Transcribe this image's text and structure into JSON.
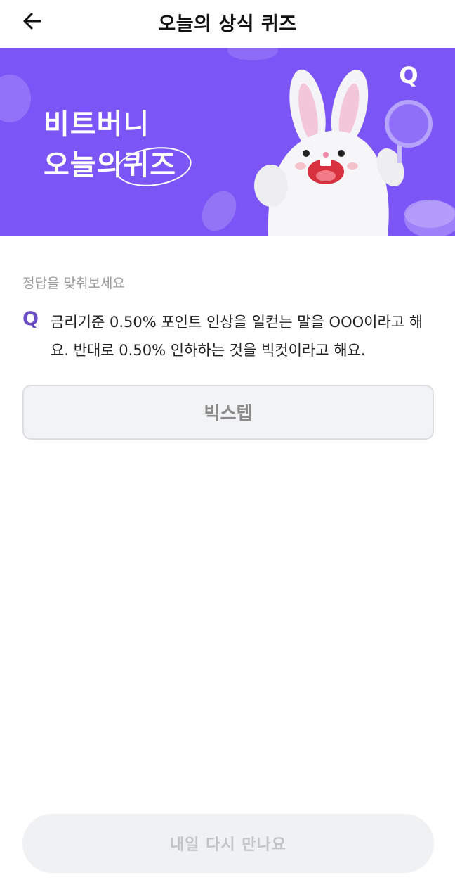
{
  "header": {
    "title": "오늘의 상식 퀴즈",
    "back_icon": "arrow-left-icon"
  },
  "banner": {
    "line1": "비트버니",
    "line2_prefix": "오늘의",
    "line2_highlight": "퀴즈",
    "badge_letter": "Q",
    "colors": {
      "background": "#7b55f5"
    }
  },
  "quiz": {
    "prompt": "정답을 맞춰보세요",
    "q_label": "Q",
    "question": "금리기준 0.50% 포인트 인상을 일컫는 말을 OOO이라고 해요. 반대로 0.50% 인하하는 것을 빅컷이라고 해요.",
    "answer": "빅스텝"
  },
  "footer": {
    "button_label": "내일 다시 만나요"
  },
  "colors": {
    "accent": "#6a4fc4",
    "answer_bg": "#f2f3f5",
    "disabled_text": "#c1c3c7"
  }
}
